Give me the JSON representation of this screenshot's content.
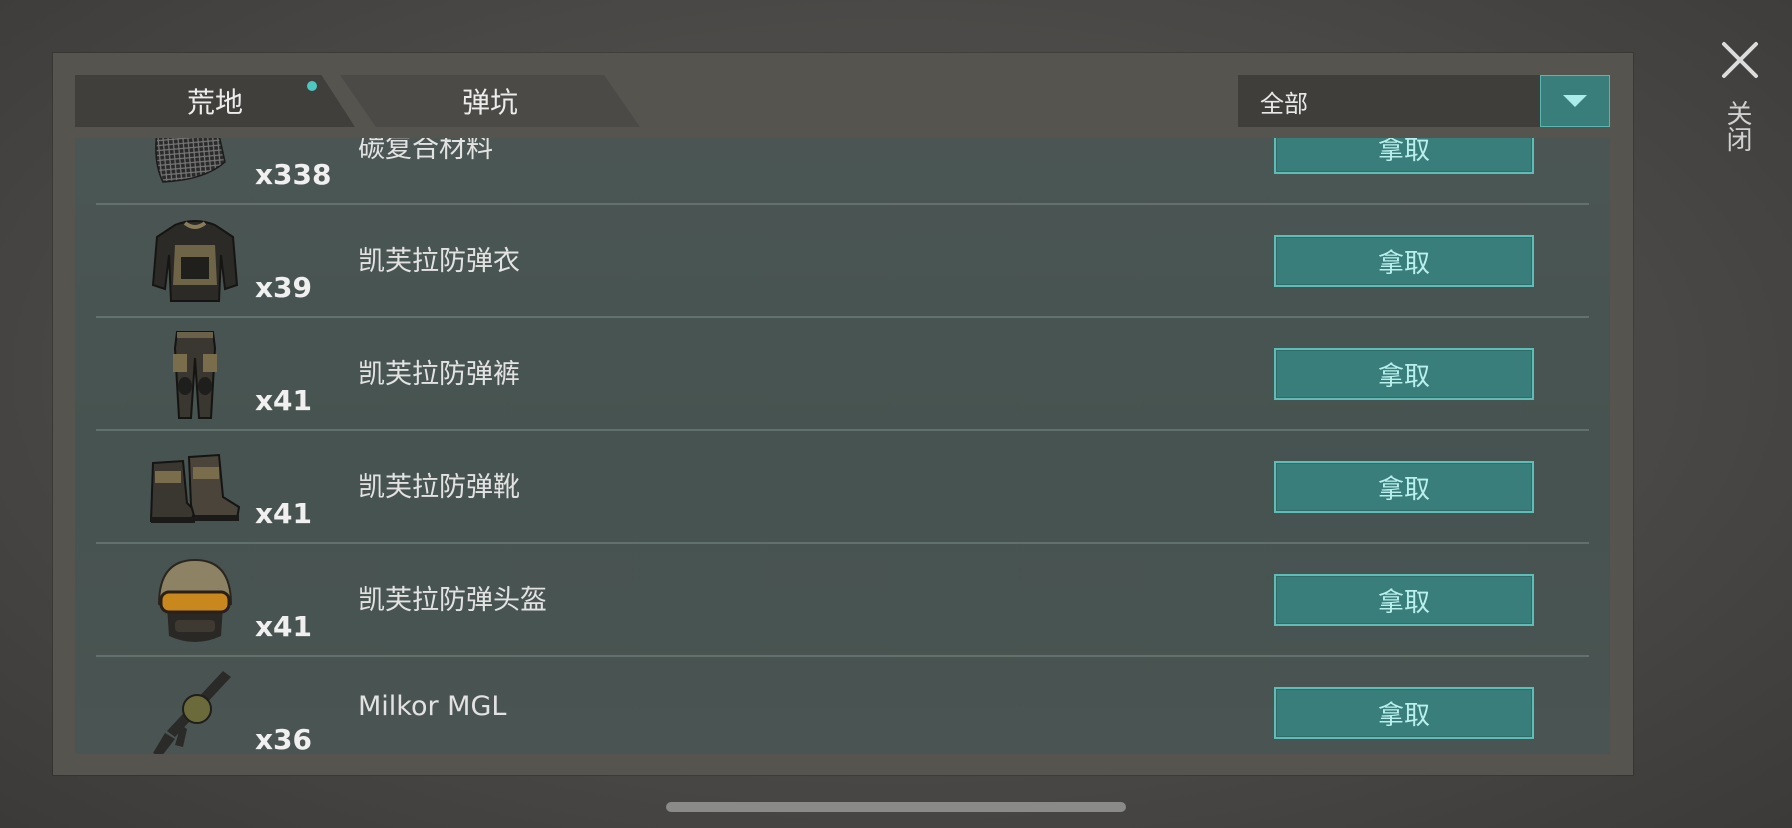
{
  "tabs": [
    {
      "label": "荒地",
      "active": true,
      "has_notification": true
    },
    {
      "label": "弹坑",
      "active": false,
      "has_notification": false
    }
  ],
  "filter": {
    "selected": "全部",
    "dropdown_icon": "chevron-down-icon"
  },
  "close": {
    "icon": "close-icon",
    "label": "关闭"
  },
  "colors": {
    "accent": "#3a7e7c",
    "accent_border": "#5dbeb8",
    "notification_dot": "#4cc7c2"
  },
  "items": [
    {
      "name": "碳复合材料",
      "quantity": "x338",
      "icon": "carbon-mesh-icon",
      "action": "拿取"
    },
    {
      "name": "凯芙拉防弹衣",
      "quantity": "x39",
      "icon": "body-armor-icon",
      "action": "拿取"
    },
    {
      "name": "凯芙拉防弹裤",
      "quantity": "x41",
      "icon": "armored-pants-icon",
      "action": "拿取"
    },
    {
      "name": "凯芙拉防弹靴",
      "quantity": "x41",
      "icon": "armored-boots-icon",
      "action": "拿取"
    },
    {
      "name": "凯芙拉防弹头盔",
      "quantity": "x41",
      "icon": "helmet-icon",
      "action": "拿取"
    },
    {
      "name": "Milkor MGL",
      "quantity": "x36",
      "icon": "grenade-launcher-icon",
      "action": "拿取"
    }
  ]
}
